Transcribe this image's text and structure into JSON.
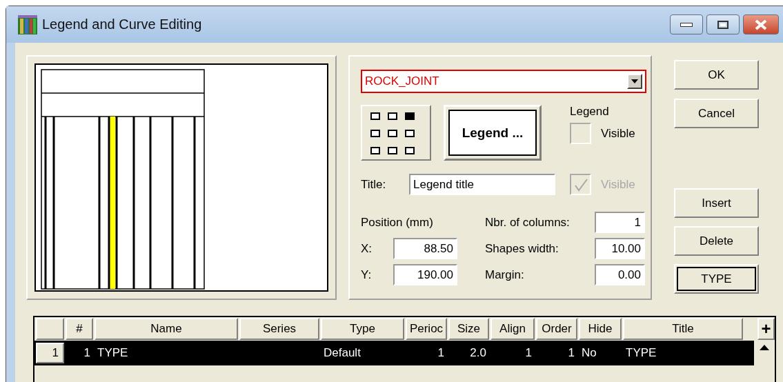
{
  "window": {
    "title": "Legend and Curve Editing"
  },
  "curve_select": {
    "value": "ROCK_JOINT"
  },
  "position_grid": [
    {
      "selected": false
    },
    {
      "selected": false
    },
    {
      "selected": true
    },
    {
      "selected": false
    },
    {
      "selected": false
    },
    {
      "selected": false
    },
    {
      "selected": false
    },
    {
      "selected": false
    },
    {
      "selected": false
    }
  ],
  "legend_button": "Legend ...",
  "legend_group": {
    "label": "Legend",
    "visible_label": "Visible",
    "visible_checked": false
  },
  "title_row": {
    "label": "Title:",
    "value": "Legend title",
    "visible_label": "Visible",
    "visible_checked": true,
    "visible_disabled": true
  },
  "position": {
    "label": "Position (mm)",
    "fields": [
      {
        "label": "X:",
        "value": "88.50"
      },
      {
        "label": "Y:",
        "value": "190.00"
      }
    ]
  },
  "options": [
    {
      "label": "Nbr. of columns:",
      "value": "1"
    },
    {
      "label": "Shapes width:",
      "value": "10.00"
    },
    {
      "label": "Margin:",
      "value": "0.00"
    }
  ],
  "buttons": [
    {
      "label": "OK",
      "default": false
    },
    {
      "label": "Cancel",
      "default": false
    },
    {
      "label": "Insert",
      "default": false
    },
    {
      "label": "Delete",
      "default": false
    },
    {
      "label": "TYPE",
      "default": true
    }
  ],
  "table": {
    "columns": [
      "#",
      "Name",
      "Series",
      "Type",
      "Perioc",
      "Size",
      "Align",
      "Order",
      "Hide",
      "Title"
    ],
    "add_button": "+",
    "rows": [
      {
        "row_header": "1",
        "selected": true,
        "cells": [
          "1",
          "TYPE",
          null,
          "Default",
          "1",
          "2.0",
          "1",
          "1",
          "No",
          "TYPE"
        ]
      }
    ]
  }
}
